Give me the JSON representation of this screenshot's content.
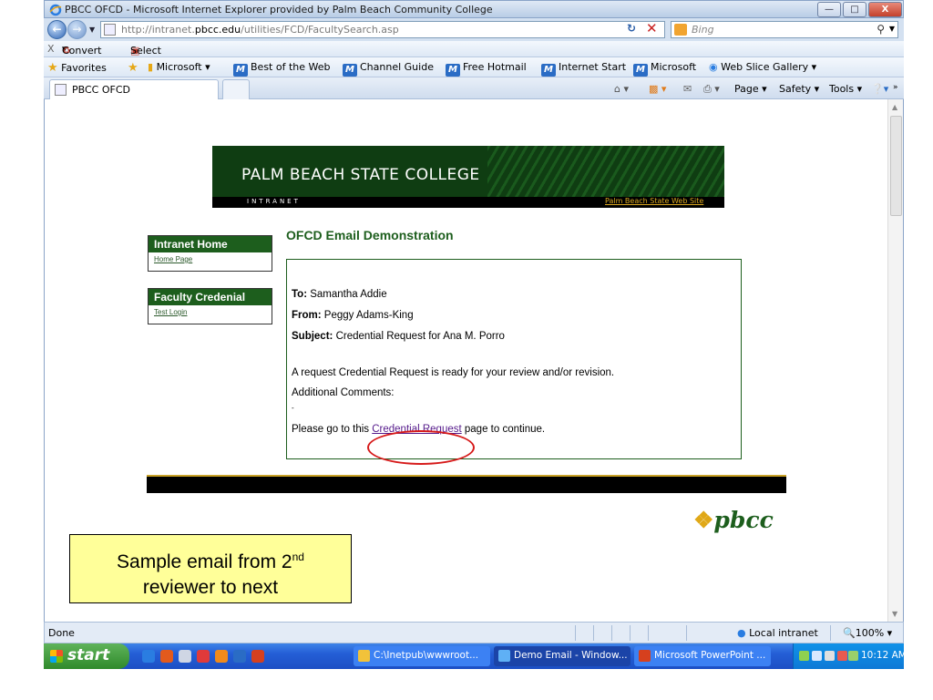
{
  "window": {
    "title": "PBCC OFCD - Microsoft Internet Explorer provided by Palm Beach Community College",
    "minimize_label": "—",
    "maximize_label": "□",
    "close_label": "X"
  },
  "address": {
    "url_prefix": "http://intranet.",
    "url_host": "pbcc.edu",
    "url_path": "/utilities/FCD/FacultySearch.asp",
    "search_placeholder": "Bing"
  },
  "convertbar": {
    "close_label": "X",
    "convert_label": "Convert",
    "select_label": "Select"
  },
  "favorites_bar": {
    "favorites_label": "Favorites",
    "items": [
      "Microsoft ▾",
      "Best of the Web",
      "Channel Guide",
      "Free Hotmail",
      "Internet Start",
      "Microsoft",
      "Web Slice Gallery ▾"
    ]
  },
  "tabs": {
    "active_label": "PBCC OFCD"
  },
  "commandbar": {
    "page_label": "Page ▾",
    "safety_label": "Safety ▾",
    "tools_label": "Tools ▾"
  },
  "banner": {
    "college_name": "PALM BEACH STATE COLLEGE",
    "section": "INTRANET",
    "site_link": "Palm Beach State Web Site"
  },
  "sidebar": {
    "boxes": [
      {
        "heading": "Intranet Home",
        "link": "Home Page"
      },
      {
        "heading": "Faculty Credenial",
        "link": "Test Login"
      }
    ]
  },
  "main": {
    "heading": "OFCD Email Demonstration",
    "email": {
      "to_label": "To:",
      "to_value": "Samantha Addie",
      "from_label": "From:",
      "from_value": "Peggy Adams-King",
      "subject_label": "Subject:",
      "subject_value": "Credential Request for Ana M. Porro",
      "body_line1": "A request Credential Request is ready for your review and/or revision.",
      "comments_label": "Additional Comments:",
      "comments_value": "-",
      "cta_before": "Please go to this ",
      "cta_link": "Credential Request",
      "cta_after": " page to continue."
    }
  },
  "logo": {
    "text": "pbcc"
  },
  "annotation": {
    "line1_a": "Sample email from 2",
    "line1_sup": "nd",
    "line2": "reviewer to next"
  },
  "statusbar": {
    "status": "Done",
    "zone": "Local intranet",
    "zoom": "100%"
  },
  "taskbar": {
    "start_label": "start",
    "tasks": [
      "C:\\Inetpub\\wwwroot...",
      "Demo Email - Window...",
      "Microsoft PowerPoint ..."
    ],
    "clock": "10:12 AM"
  },
  "colors": {
    "college_green": "#1d5e1d",
    "link_gold": "#d8a520",
    "annotation_yellow": "#ffff99",
    "highlight_red": "#d61a1a"
  }
}
